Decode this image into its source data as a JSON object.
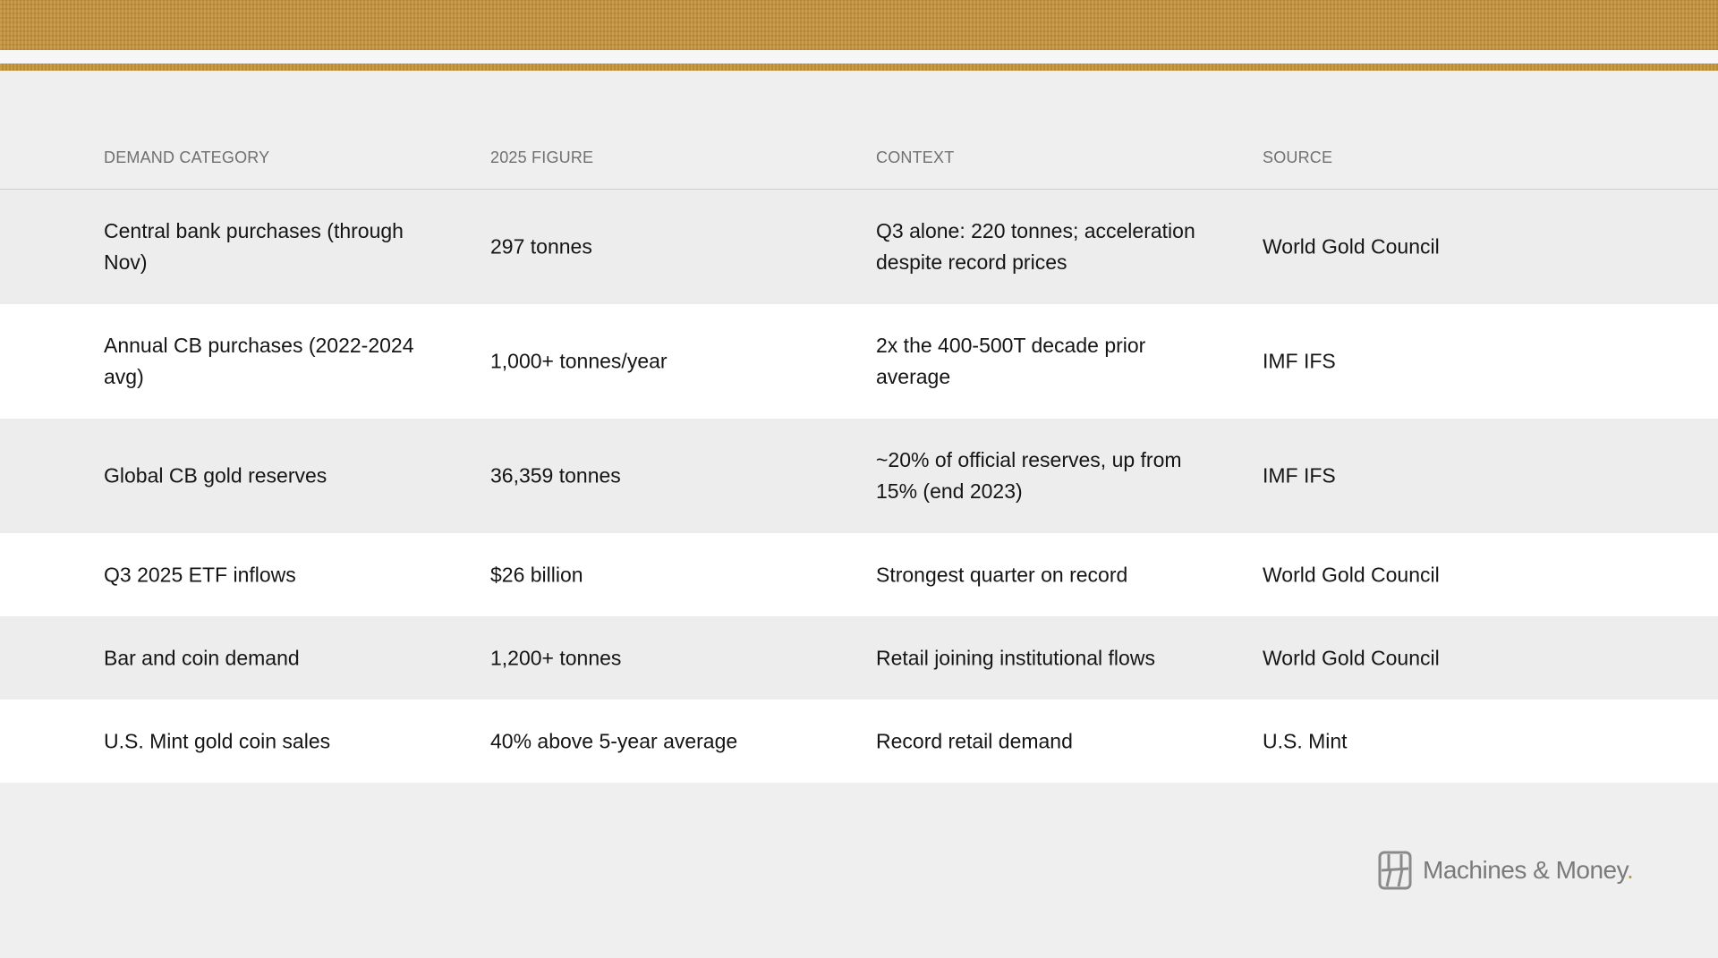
{
  "table": {
    "headers": [
      "DEMAND CATEGORY",
      "2025 FIGURE",
      "CONTEXT",
      "SOURCE"
    ],
    "rows": [
      {
        "category": "Central bank purchases (through Nov)",
        "figure": "297 tonnes",
        "context": "Q3 alone: 220 tonnes; acceleration despite record prices",
        "source": "World Gold Council"
      },
      {
        "category": "Annual CB purchases (2022-2024 avg)",
        "figure": "1,000+ tonnes/year",
        "context": "2x the 400-500T decade prior average",
        "source": "IMF IFS"
      },
      {
        "category": "Global CB gold reserves",
        "figure": "36,359 tonnes",
        "context": "~20% of official reserves, up from 15% (end 2023)",
        "source": "IMF IFS"
      },
      {
        "category": "Q3 2025 ETF inflows",
        "figure": "$26 billion",
        "context": "Strongest quarter on record",
        "source": "World Gold Council"
      },
      {
        "category": "Bar and coin demand",
        "figure": "1,200+ tonnes",
        "context": "Retail joining institutional flows",
        "source": "World Gold Council"
      },
      {
        "category": "U.S. Mint gold coin sales",
        "figure": "40% above 5-year average",
        "context": "Record retail demand",
        "source": "U.S. Mint"
      }
    ]
  },
  "logo": {
    "text": "Machines & Money",
    "dot": ".",
    "icon": "machines-and-money-logo-icon"
  },
  "colors": {
    "gold": "#c4933a",
    "background": "#efefef",
    "row_shaded": "#ededed",
    "row_white": "#ffffff",
    "header_text": "#707070"
  }
}
